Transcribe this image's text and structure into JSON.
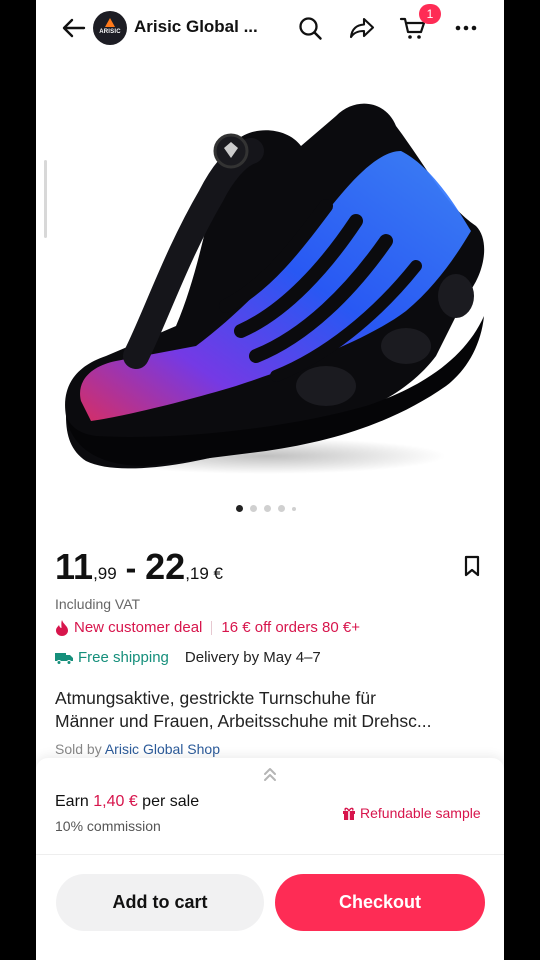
{
  "header": {
    "shop_name": "Arisic Global ...",
    "logo_text": "ARISIC",
    "cart_count": "1",
    "icons": [
      "back-arrow-icon",
      "search-icon",
      "share-icon",
      "cart-icon",
      "more-icon"
    ]
  },
  "gallery": {
    "image": "black and blue sneaker with rotary lace dial",
    "page_count": 5,
    "active_index": 0
  },
  "price": {
    "low_whole": "11",
    "low_cents": ",99",
    "dash": " - ",
    "high_whole": "22",
    "high_cents": ",19 €",
    "vat": "Including VAT"
  },
  "deal": {
    "label": "New customer deal",
    "offer": "16 € off orders 80 €+"
  },
  "shipping": {
    "free": "Free shipping",
    "delivery": "Delivery by May 4–7"
  },
  "product": {
    "title_line1": "Atmungsaktive, gestrickte Turnschuhe für",
    "title_line2": "Männer und Frauen, Arbeitsschuhe mit Drehsc...",
    "sold_by_prefix": "Sold by ",
    "sold_by_shop": "Arisic Global Shop"
  },
  "affiliate": {
    "earn_prefix": "Earn ",
    "earn_amount": "1,40 €",
    "earn_suffix": " per sale",
    "commission": "10% commission",
    "refundable": "Refundable sample"
  },
  "actions": {
    "add_to_cart": "Add to cart",
    "checkout": "Checkout"
  },
  "colors": {
    "accent": "#fe2c55",
    "deal": "#d7154c",
    "shipping": "#158f7b",
    "link": "#2c5b9a"
  }
}
